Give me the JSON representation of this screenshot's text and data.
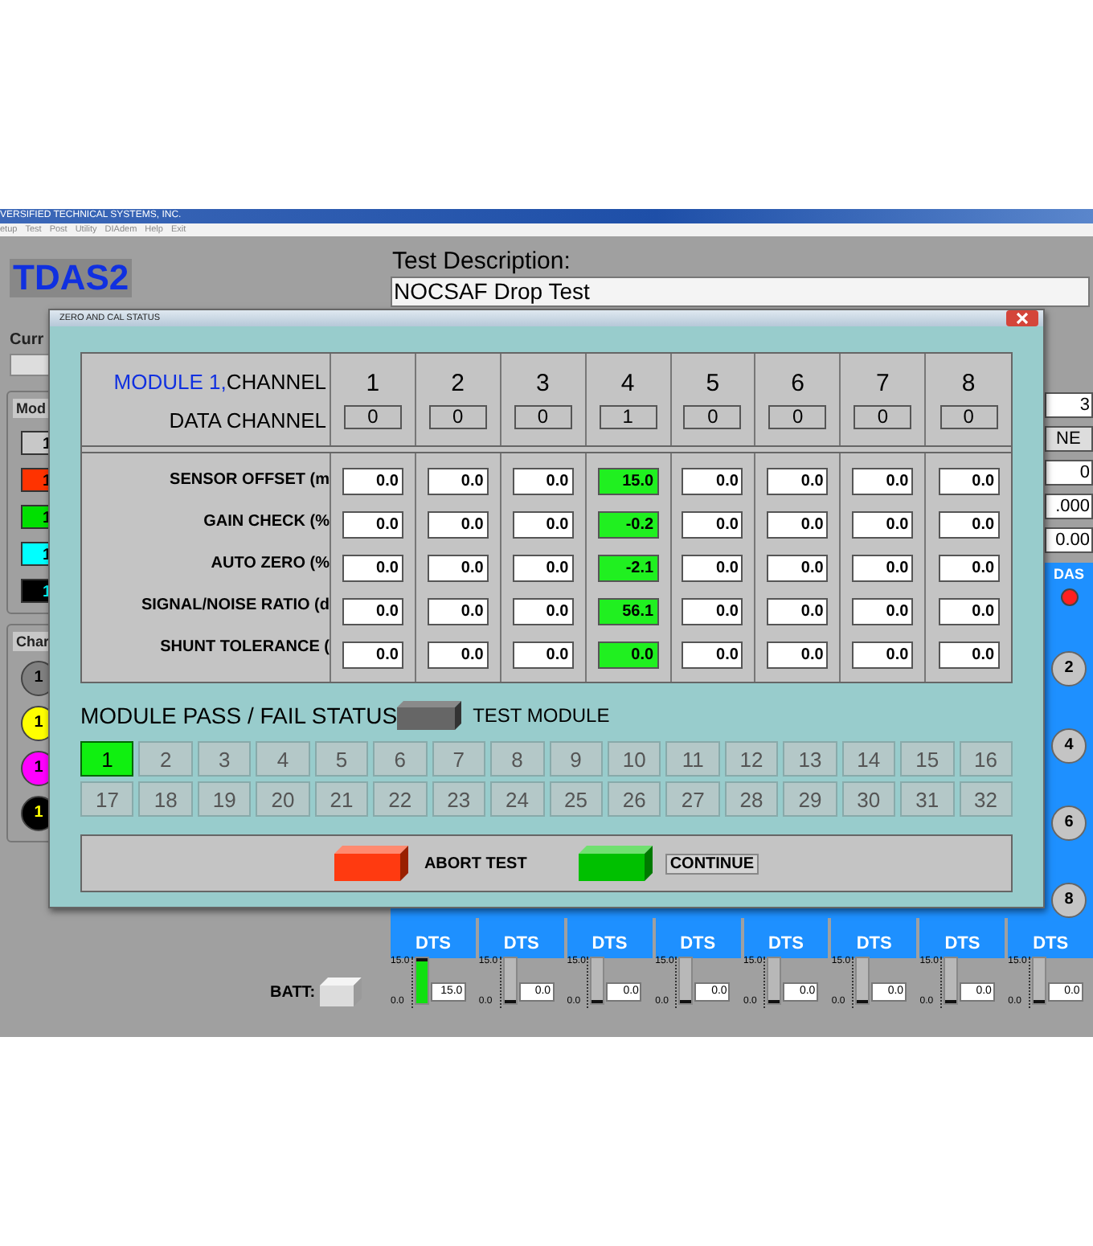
{
  "app": {
    "title": "VERSIFIED TECHNICAL SYSTEMS, INC.",
    "menu": [
      "etup",
      "Test",
      "Post",
      "Utility",
      "DIAdem",
      "Help",
      "Exit"
    ],
    "logo": "TDAS2",
    "test_description_label": "Test Description:",
    "test_description": "NOCSAF Drop Test"
  },
  "left_panel": {
    "current_label": "Curr",
    "module_label": "Mod",
    "modules": [
      {
        "value": "1",
        "color": "#c8c8c8"
      },
      {
        "value": "1",
        "color": "#ff3300"
      },
      {
        "value": "1",
        "color": "#00e000"
      },
      {
        "value": "1",
        "color": "#00ffff"
      },
      {
        "value": "1",
        "color": "#000000"
      }
    ],
    "channel_label": "Char",
    "channels": [
      {
        "value": "1",
        "color": "#808080"
      },
      {
        "value": "1",
        "color": "#ffff00"
      },
      {
        "value": "1",
        "color": "#ff00ff"
      },
      {
        "value": "1",
        "color": "#000000"
      }
    ]
  },
  "right_panel": {
    "fields": [
      "3",
      "NE",
      "0",
      ".000",
      "0.00"
    ],
    "das_label": "DAS",
    "status_on": true,
    "channels": [
      "2",
      "4",
      "6",
      "8"
    ]
  },
  "batt_label": "BATT:",
  "dts_units": [
    {
      "label": "DTS",
      "max": "15.0",
      "min": "0.0",
      "level": 1,
      "reading": "15.0"
    },
    {
      "label": "DTS",
      "max": "15.0",
      "min": "0.0",
      "level": 0,
      "reading": "0.0"
    },
    {
      "label": "DTS",
      "max": "15.0",
      "min": "0.0",
      "level": 0,
      "reading": "0.0"
    },
    {
      "label": "DTS",
      "max": "15.0",
      "min": "0.0",
      "level": 0,
      "reading": "0.0"
    },
    {
      "label": "DTS",
      "max": "15.0",
      "min": "0.0",
      "level": 0,
      "reading": "0.0"
    },
    {
      "label": "DTS",
      "max": "15.0",
      "min": "0.0",
      "level": 0,
      "reading": "0.0"
    },
    {
      "label": "DTS",
      "max": "15.0",
      "min": "0.0",
      "level": 0,
      "reading": "0.0"
    },
    {
      "label": "DTS",
      "max": "15.0",
      "min": "0.0",
      "level": 0,
      "reading": "0.0"
    }
  ],
  "dialog": {
    "title": "ZERO AND CAL STATUS",
    "module_label": "MODULE 1,",
    "channel_label": "CHANNEL",
    "data_channel_label": "DATA CHANNEL",
    "channels": [
      {
        "number": "1",
        "data_channel": "0"
      },
      {
        "number": "2",
        "data_channel": "0"
      },
      {
        "number": "3",
        "data_channel": "0"
      },
      {
        "number": "4",
        "data_channel": "1"
      },
      {
        "number": "5",
        "data_channel": "0"
      },
      {
        "number": "6",
        "data_channel": "0"
      },
      {
        "number": "7",
        "data_channel": "0"
      },
      {
        "number": "8",
        "data_channel": "0"
      }
    ],
    "rows": [
      {
        "label": "SENSOR OFFSET (m",
        "values": [
          {
            "value": "0.0",
            "highlighted": false
          },
          {
            "value": "0.0",
            "highlighted": false
          },
          {
            "value": "0.0",
            "highlighted": false
          },
          {
            "value": "15.0",
            "highlighted": true
          },
          {
            "value": "0.0",
            "highlighted": false
          },
          {
            "value": "0.0",
            "highlighted": false
          },
          {
            "value": "0.0",
            "highlighted": false
          },
          {
            "value": "0.0",
            "highlighted": false
          }
        ]
      },
      {
        "label": "GAIN CHECK (%",
        "values": [
          {
            "value": "0.0",
            "highlighted": false
          },
          {
            "value": "0.0",
            "highlighted": false
          },
          {
            "value": "0.0",
            "highlighted": false
          },
          {
            "value": "-0.2",
            "highlighted": true
          },
          {
            "value": "0.0",
            "highlighted": false
          },
          {
            "value": "0.0",
            "highlighted": false
          },
          {
            "value": "0.0",
            "highlighted": false
          },
          {
            "value": "0.0",
            "highlighted": false
          }
        ]
      },
      {
        "label": "AUTO ZERO (%",
        "values": [
          {
            "value": "0.0",
            "highlighted": false
          },
          {
            "value": "0.0",
            "highlighted": false
          },
          {
            "value": "0.0",
            "highlighted": false
          },
          {
            "value": "-2.1",
            "highlighted": true
          },
          {
            "value": "0.0",
            "highlighted": false
          },
          {
            "value": "0.0",
            "highlighted": false
          },
          {
            "value": "0.0",
            "highlighted": false
          },
          {
            "value": "0.0",
            "highlighted": false
          }
        ]
      },
      {
        "label": "SIGNAL/NOISE RATIO (d",
        "values": [
          {
            "value": "0.0",
            "highlighted": false
          },
          {
            "value": "0.0",
            "highlighted": false
          },
          {
            "value": "0.0",
            "highlighted": false
          },
          {
            "value": "56.1",
            "highlighted": true
          },
          {
            "value": "0.0",
            "highlighted": false
          },
          {
            "value": "0.0",
            "highlighted": false
          },
          {
            "value": "0.0",
            "highlighted": false
          },
          {
            "value": "0.0",
            "highlighted": false
          }
        ]
      },
      {
        "label": "SHUNT TOLERANCE (",
        "values": [
          {
            "value": "0.0",
            "highlighted": false
          },
          {
            "value": "0.0",
            "highlighted": false
          },
          {
            "value": "0.0",
            "highlighted": false
          },
          {
            "value": "0.0",
            "highlighted": true
          },
          {
            "value": "0.0",
            "highlighted": false
          },
          {
            "value": "0.0",
            "highlighted": false
          },
          {
            "value": "0.0",
            "highlighted": false
          },
          {
            "value": "0.0",
            "highlighted": false
          }
        ]
      }
    ],
    "status_label": "MODULE PASS / FAIL STATUS",
    "test_module_label": "TEST MODULE",
    "modules": [
      {
        "label": "1",
        "selected": true
      },
      {
        "label": "2",
        "selected": false
      },
      {
        "label": "3",
        "selected": false
      },
      {
        "label": "4",
        "selected": false
      },
      {
        "label": "5",
        "selected": false
      },
      {
        "label": "6",
        "selected": false
      },
      {
        "label": "7",
        "selected": false
      },
      {
        "label": "8",
        "selected": false
      },
      {
        "label": "9",
        "selected": false
      },
      {
        "label": "10",
        "selected": false
      },
      {
        "label": "11",
        "selected": false
      },
      {
        "label": "12",
        "selected": false
      },
      {
        "label": "13",
        "selected": false
      },
      {
        "label": "14",
        "selected": false
      },
      {
        "label": "15",
        "selected": false
      },
      {
        "label": "16",
        "selected": false
      },
      {
        "label": "17",
        "selected": false
      },
      {
        "label": "18",
        "selected": false
      },
      {
        "label": "19",
        "selected": false
      },
      {
        "label": "20",
        "selected": false
      },
      {
        "label": "21",
        "selected": false
      },
      {
        "label": "22",
        "selected": false
      },
      {
        "label": "23",
        "selected": false
      },
      {
        "label": "24",
        "selected": false
      },
      {
        "label": "25",
        "selected": false
      },
      {
        "label": "26",
        "selected": false
      },
      {
        "label": "27",
        "selected": false
      },
      {
        "label": "28",
        "selected": false
      },
      {
        "label": "29",
        "selected": false
      },
      {
        "label": "30",
        "selected": false
      },
      {
        "label": "31",
        "selected": false
      },
      {
        "label": "32",
        "selected": false
      }
    ],
    "abort_label": "ABORT TEST",
    "continue_label": "CONTINUE"
  }
}
